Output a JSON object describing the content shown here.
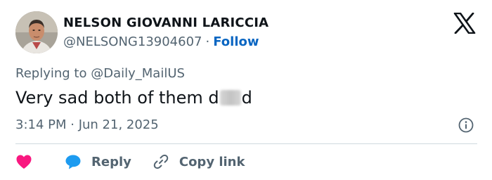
{
  "author": {
    "display_name": "NELSON GIOVANNI LARICCIA",
    "handle": "@NELSONG13904607",
    "separator": "·",
    "follow_label": "Follow"
  },
  "reply_context": {
    "prefix": "Replying to",
    "mention": "@Daily_MailUS"
  },
  "tweet": {
    "text_before": "Very sad both of them d",
    "text_after": "d",
    "timestamp": "3:14 PM · Jun 21, 2025"
  },
  "actions": {
    "reply_label": "Reply",
    "copy_link_label": "Copy link"
  },
  "icons": {
    "logo": "x-logo-icon",
    "info": "info-icon",
    "like": "heart-icon",
    "reply": "speech-bubble-icon",
    "copy": "link-icon"
  },
  "colors": {
    "follow": "#0a66c2",
    "like": "#f91880",
    "reply": "#1d9bf0",
    "muted": "#536471",
    "text": "#0f1419"
  }
}
